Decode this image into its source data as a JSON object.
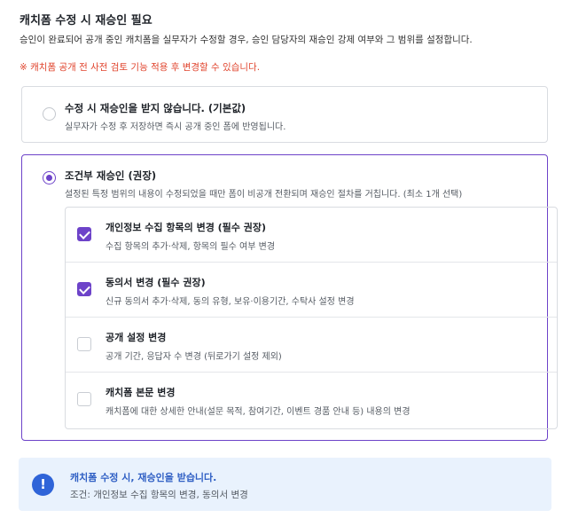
{
  "header": {
    "title": "캐치폼 수정 시 재승인 필요",
    "description": "승인이 완료되어 공개 중인 캐치폼을 실무자가 수정할 경우, 승인 담당자의 재승인 강제 여부와 그 범위를 설정합니다.",
    "notice": "※ 캐치폼 공개 전 사전 검토 기능 적용 후 변경할 수 있습니다."
  },
  "options": [
    {
      "title": "수정 시 재승인을 받지 않습니다. (기본값)",
      "desc": "실무자가 수정 후 저장하면 즉시 공개 중인 폼에 반영됩니다.",
      "selected": false
    },
    {
      "title": "조건부 재승인 (권장)",
      "desc": "설정된 특정 범위의 내용이 수정되었을 때만 폼이 비공개 전환되며 재승인 절차를 거칩니다. (최소 1개 선택)",
      "selected": true,
      "conditions": [
        {
          "title": "개인정보 수집 항목의 변경 (필수 권장)",
          "desc": "수집 항목의 추가·삭제, 항목의 필수 여부 변경",
          "checked": true
        },
        {
          "title": "동의서 변경 (필수 권장)",
          "desc": "신규 동의서 추가·삭제, 동의 유형, 보유·이용기간, 수탁사 설정 변경",
          "checked": true
        },
        {
          "title": "공개 설정 변경",
          "desc": "공개 기간, 응답자 수 변경 (뒤로가기 설정 제외)",
          "checked": false
        },
        {
          "title": "캐치폼 본문 변경",
          "desc": "캐치폼에 대한 상세한 안내(설문 목적, 참여기간, 이벤트 경품 안내 등) 내용의 변경",
          "checked": false
        }
      ]
    }
  ],
  "info": {
    "icon": "!",
    "title": "캐치폼 수정 시, 재승인을 받습니다.",
    "desc": "조건: 개인정보 수집 항목의 변경, 동의서 변경"
  },
  "colors": {
    "accent": "#6d43c9",
    "notice": "#e0442d",
    "info_bg": "#e9f2fd",
    "info_icon": "#2f64d8"
  }
}
